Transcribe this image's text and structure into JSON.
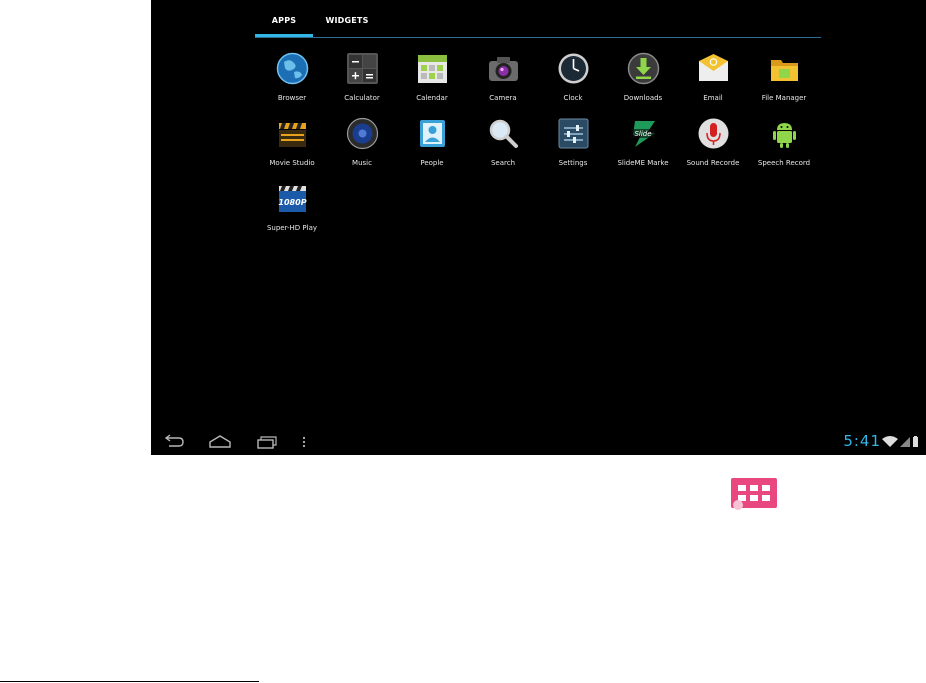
{
  "tabs": {
    "apps": "APPS",
    "widgets": "WIDGETS"
  },
  "apps": [
    {
      "label": "Browser"
    },
    {
      "label": "Calculator"
    },
    {
      "label": "Calendar"
    },
    {
      "label": "Camera"
    },
    {
      "label": "Clock"
    },
    {
      "label": "Downloads"
    },
    {
      "label": "Email"
    },
    {
      "label": "File Manager"
    },
    {
      "label": "Movie Studio"
    },
    {
      "label": "Music"
    },
    {
      "label": "People"
    },
    {
      "label": "Search"
    },
    {
      "label": "Settings"
    },
    {
      "label": "SlideME Marke"
    },
    {
      "label": "Sound Recorde"
    },
    {
      "label": "Speech Record"
    },
    {
      "label": "Super-HD Play"
    }
  ],
  "status": {
    "time": "5:41"
  },
  "colors": {
    "accent": "#33b5e5",
    "apps_button": "#e8477f"
  }
}
